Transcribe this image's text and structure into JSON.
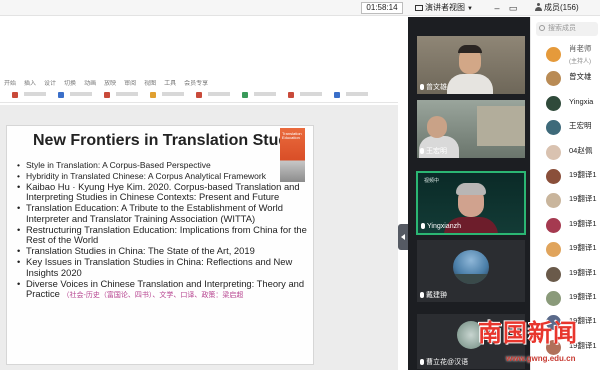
{
  "topbar": {
    "timer": "01:58:14",
    "view_button": "演讲者视图",
    "members_title": "成员(156)"
  },
  "ribbon_tabs": [
    "开始",
    "插入",
    "设计",
    "切换",
    "动画",
    "放映",
    "审阅",
    "视图",
    "工具",
    "会员专享"
  ],
  "slide": {
    "title": "New Frontiers in Translation Studie",
    "book_title": "Translation Education",
    "bullets": [
      {
        "text": "Style in Translation: A Corpus-Based Perspective",
        "size": "normal"
      },
      {
        "text": "Hybridity in Translated Chinese: A Corpus Analytical Framework",
        "size": "normal"
      },
      {
        "text": "Kaibao Hu · Kyung Hye Kim. 2020. Corpus-based Translation and Interpreting Studies in Chinese Contexts: Present and Future",
        "size": "large"
      },
      {
        "text": "Translation Education: A Tribute to the Establishment of World Interpreter and Translator Training Association (WITTA)",
        "size": "large"
      },
      {
        "text": "Restructuring Translation Education: Implications from China for the Rest of the World",
        "size": "large"
      },
      {
        "text": "Translation Studies in China: The State of the Art, 2019",
        "size": "large"
      },
      {
        "text": "Key Issues in Translation Studies in China: Reflections and New Insights 2020",
        "size": "large"
      },
      {
        "text": "Diverse Voices in Chinese Translation and Interpreting: Theory and Practice",
        "size": "large"
      }
    ],
    "last_bullet_note": "（社会-历史（富国论、四书）、文学、口译、政策：梁启超"
  },
  "video_tiles": [
    {
      "name": "曾文雄",
      "active": false
    },
    {
      "name": "王宏明",
      "active": false
    },
    {
      "name": "Yingxianzh",
      "active": true,
      "label": "视频中"
    },
    {
      "name": "戴建翀",
      "active": false
    },
    {
      "name": "曹立花@汉语",
      "active": false
    }
  ],
  "member_search_placeholder": "搜索成员",
  "members": [
    {
      "name": "肖老师",
      "sub": "(主持人)",
      "color": "#e59a3b"
    },
    {
      "name": "曾文雄",
      "sub": "",
      "color": "#b98b55"
    },
    {
      "name": "Yingxia",
      "sub": "",
      "color": "#2f4a3a"
    },
    {
      "name": "王宏明",
      "sub": "",
      "color": "#3e6a7a"
    },
    {
      "name": "04赵佩",
      "sub": "",
      "color": "#d9c2b0"
    },
    {
      "name": "19翻译1",
      "sub": "",
      "color": "#8a4f3a"
    },
    {
      "name": "19翻译1",
      "sub": "",
      "color": "#c9b59c"
    },
    {
      "name": "19翻译1",
      "sub": "",
      "color": "#a53a50"
    },
    {
      "name": "19翻译1",
      "sub": "",
      "color": "#e0a45c"
    },
    {
      "name": "19翻译1",
      "sub": "",
      "color": "#6a5a4a"
    },
    {
      "name": "19翻译1",
      "sub": "",
      "color": "#8a9a7a"
    },
    {
      "name": "19翻译1",
      "sub": "",
      "color": "#5a6a8a"
    },
    {
      "name": "19翻译1",
      "sub": "",
      "color": "#b0705a"
    }
  ],
  "watermark": {
    "big": "南国新闻",
    "url": "www.gwng.edu.cn"
  },
  "colors": {
    "active_speaker": "#2bb673",
    "watermark_red": "#e8362d",
    "book_orange": "#d94e27"
  }
}
